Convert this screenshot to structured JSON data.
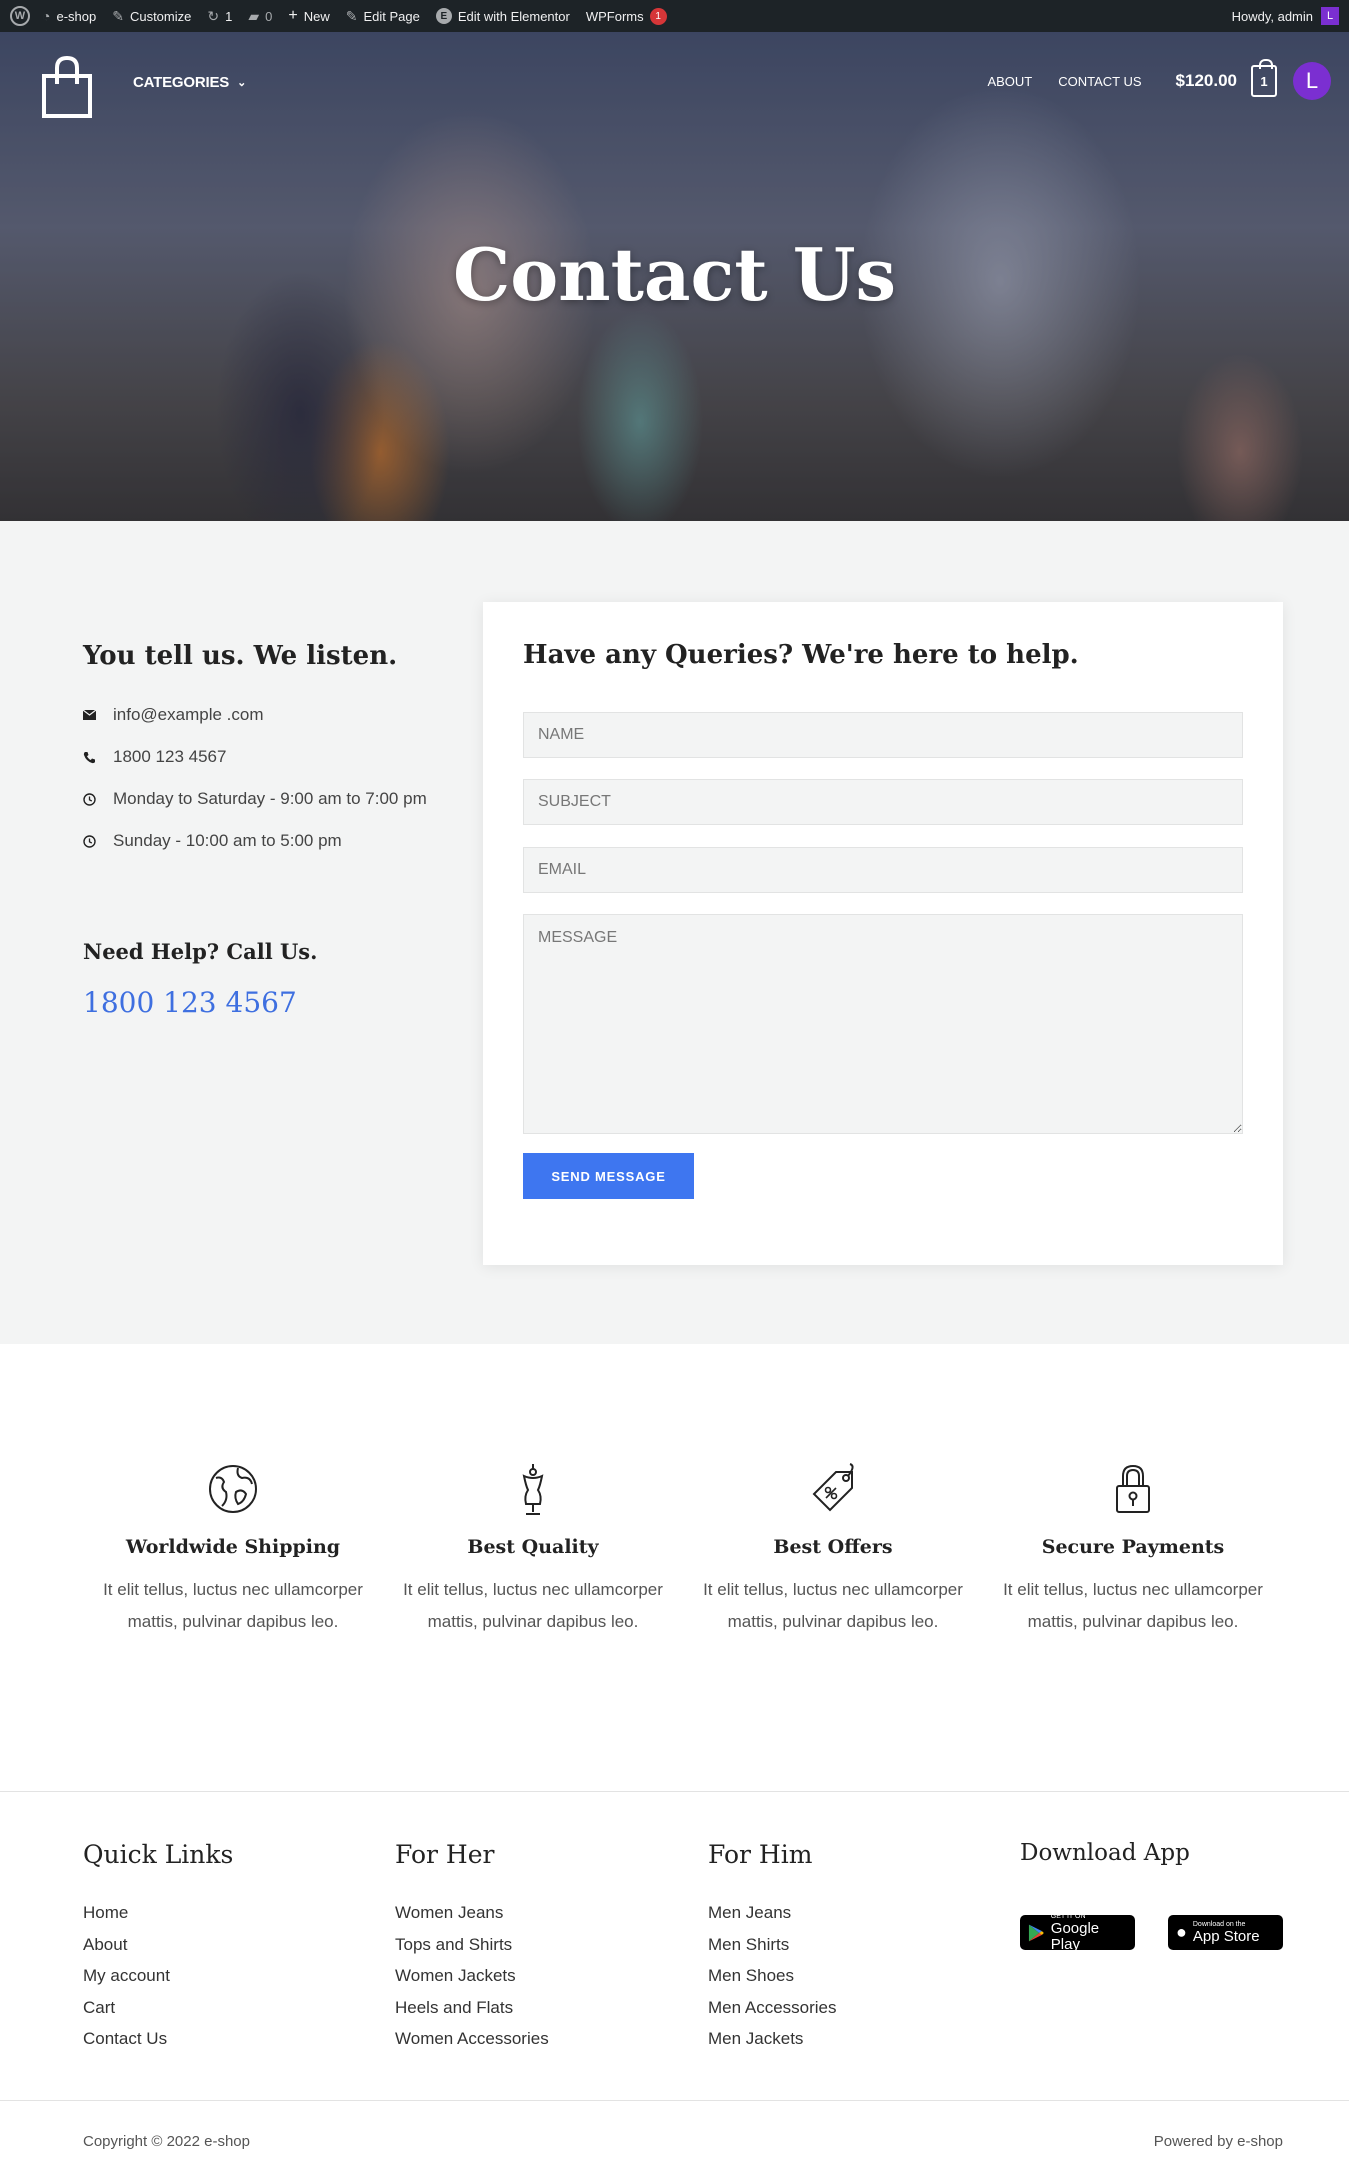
{
  "adminbar": {
    "site_name": "e-shop",
    "customize": "Customize",
    "updates_count": "1",
    "comments_count": "0",
    "new": "New",
    "edit_page": "Edit Page",
    "edit_elementor": "Edit with Elementor",
    "wpforms": "WPForms",
    "wpforms_badge": "1",
    "howdy": "Howdy, admin",
    "avatar_letter": "L"
  },
  "nav": {
    "categories": "CATEGORIES",
    "about": "ABOUT",
    "contact": "CONTACT US",
    "cart_total": "$120.00",
    "cart_count": "1",
    "avatar_letter": "L"
  },
  "hero": {
    "title": "Contact Us"
  },
  "contact_info": {
    "title": "You tell us. We listen.",
    "email": "info@example .com",
    "phone": "1800 123 4567",
    "hours_weekday": "Monday to Saturday - 9:00 am to 7:00 pm",
    "hours_sunday": "Sunday - 10:00 am to 5:00 pm",
    "help_title": "Need Help? Call Us.",
    "help_phone": "1800 123 4567"
  },
  "form": {
    "title": "Have any Queries? We're here to help.",
    "name_placeholder": "NAME",
    "subject_placeholder": "SUBJECT",
    "email_placeholder": "EMAIL",
    "message_placeholder": "MESSAGE",
    "send_label": "SEND MESSAGE",
    "accent_color": "#3e76f0"
  },
  "features": [
    {
      "icon": "globe-icon",
      "title": "Worldwide Shipping",
      "text": "It elit tellus, luctus nec ullamcorper mattis, pulvinar dapibus leo."
    },
    {
      "icon": "mannequin-icon",
      "title": "Best Quality",
      "text": "It elit tellus, luctus nec ullamcorper mattis, pulvinar dapibus leo."
    },
    {
      "icon": "price-tag-icon",
      "title": "Best Offers",
      "text": "It elit tellus, luctus nec ullamcorper mattis, pulvinar dapibus leo."
    },
    {
      "icon": "padlock-icon",
      "title": "Secure Payments",
      "text": "It elit tellus, luctus nec ullamcorper mattis, pulvinar dapibus leo."
    }
  ],
  "footer": {
    "quick_links": {
      "title": "Quick Links",
      "items": [
        "Home",
        "About",
        "My account",
        "Cart",
        "Contact Us"
      ]
    },
    "for_her": {
      "title": "For Her",
      "items": [
        "Women Jeans",
        "Tops and Shirts",
        "Women Jackets",
        "Heels and Flats",
        "Women Accessories"
      ]
    },
    "for_him": {
      "title": "For Him",
      "items": [
        "Men Jeans",
        "Men Shirts",
        "Men Shoes",
        "Men Accessories",
        "Men Jackets"
      ]
    },
    "download": {
      "title": "Download App",
      "google_small": "GET IT ON",
      "google_big": "Google Play",
      "apple_small": "Download on the",
      "apple_big": "App Store"
    },
    "copyright": "Copyright © 2022 e-shop",
    "powered": "Powered by e-shop"
  }
}
